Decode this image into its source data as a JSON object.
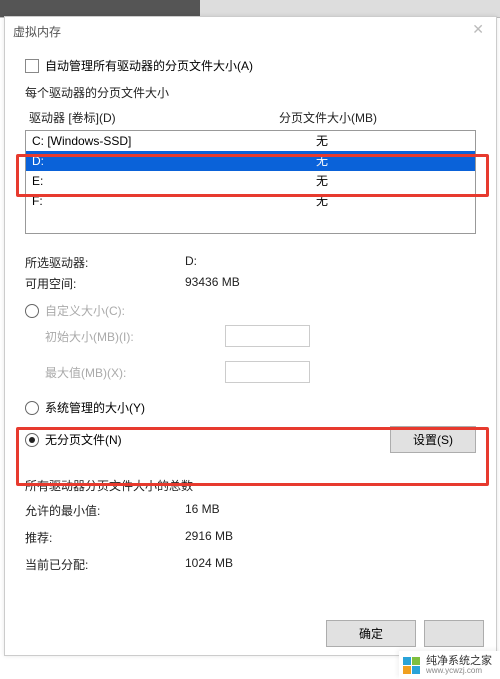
{
  "window": {
    "title": "虚拟内存"
  },
  "auto_manage": {
    "label": "自动管理所有驱动器的分页文件大小(A)",
    "checked": false
  },
  "drive_section": {
    "header": "每个驱动器的分页文件大小",
    "col_drive": "驱动器 [卷标](D)",
    "col_size": "分页文件大小(MB)",
    "drives": [
      {
        "drive": "C:",
        "label": "[Windows-SSD]",
        "size": "无",
        "selected": false
      },
      {
        "drive": "D:",
        "label": "",
        "size": "无",
        "selected": true
      },
      {
        "drive": "E:",
        "label": "",
        "size": "无",
        "selected": false
      },
      {
        "drive": "F:",
        "label": "",
        "size": "无",
        "selected": false
      }
    ]
  },
  "selected_drive": {
    "label": "所选驱动器:",
    "value": "D:",
    "avail_label": "可用空间:",
    "avail_value": "93436 MB"
  },
  "options": {
    "custom_label": "自定义大小(C):",
    "initial_label": "初始大小(MB)(I):",
    "max_label": "最大值(MB)(X):",
    "system_label": "系统管理的大小(Y)",
    "none_label": "无分页文件(N)",
    "set_button": "设置(S)",
    "selection": "none"
  },
  "totals": {
    "header": "所有驱动器分页文件大小的总数",
    "min_label": "允许的最小值:",
    "min_value": "16 MB",
    "rec_label": "推荐:",
    "rec_value": "2916 MB",
    "cur_label": "当前已分配:",
    "cur_value": "1024 MB"
  },
  "buttons": {
    "ok": "确定"
  },
  "watermark": {
    "cn": "纯净系统之家",
    "url": "www.ycwzj.com"
  }
}
